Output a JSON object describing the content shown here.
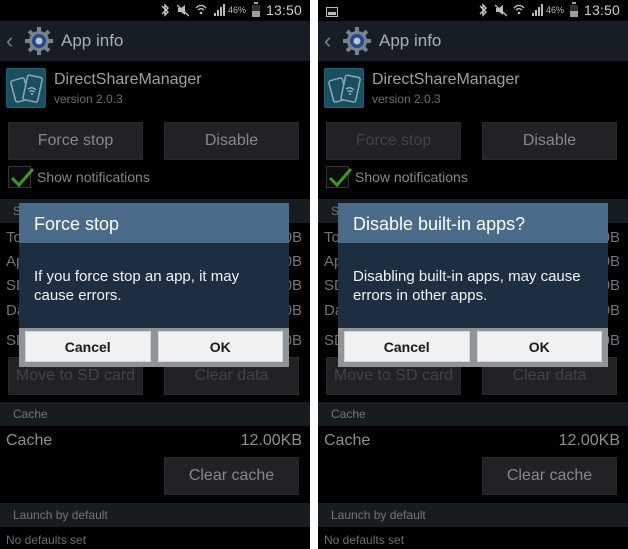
{
  "screens": [
    {
      "id": "left",
      "status_bar": {
        "icons": [
          "bluetooth-icon",
          "mute-icon",
          "wifi-icon",
          "signal-icon"
        ],
        "battery_percent": "46%",
        "time": "13:50",
        "notification_icons": []
      },
      "action_bar": {
        "back_icon": "chevron-left-icon",
        "app_icon": "settings-gear-icon",
        "title": "App info"
      },
      "app": {
        "icon": "direct-share-icon",
        "name": "DirectShareManager",
        "version": "version 2.0.3"
      },
      "buttons": {
        "force_stop": "Force stop",
        "disable": "Disable",
        "move_to_sd": "Move to SD card",
        "clear_data": "Clear data",
        "clear_cache": "Clear cache"
      },
      "force_stop_enabled": true,
      "show_notifications": {
        "label": "Show notifications",
        "checked": true
      },
      "storage": {
        "header": "S",
        "rows": [
          {
            "label": "To",
            "value": "0B"
          },
          {
            "label": "Ap",
            "value": "0B"
          },
          {
            "label": "SD",
            "value": "0B"
          },
          {
            "label": "Da",
            "value": "0B"
          },
          {
            "label": "SD",
            "value": "0B"
          }
        ]
      },
      "cache": {
        "header": "Cache",
        "label": "Cache",
        "value": "12.00KB"
      },
      "launch": {
        "header": "Launch by default",
        "text": "No defaults set"
      },
      "dialog": {
        "title": "Force stop",
        "message": "If you force stop an app, it may cause errors.",
        "cancel": "Cancel",
        "ok": "OK"
      }
    },
    {
      "id": "right",
      "status_bar": {
        "icons": [
          "bluetooth-icon",
          "mute-icon",
          "wifi-icon",
          "signal-icon"
        ],
        "battery_percent": "46%",
        "time": "13:50",
        "notification_icons": [
          "gallery-icon"
        ]
      },
      "action_bar": {
        "back_icon": "chevron-left-icon",
        "app_icon": "settings-gear-icon",
        "title": "App info"
      },
      "app": {
        "icon": "direct-share-icon",
        "name": "DirectShareManager",
        "version": "version 2.0.3"
      },
      "buttons": {
        "force_stop": "Force stop",
        "disable": "Disable",
        "move_to_sd": "Move to SD card",
        "clear_data": "Clear data",
        "clear_cache": "Clear cache"
      },
      "force_stop_enabled": false,
      "show_notifications": {
        "label": "Show notifications",
        "checked": true
      },
      "storage": {
        "header": "S",
        "rows": [
          {
            "label": "To",
            "value": "0B"
          },
          {
            "label": "Ap",
            "value": "0B"
          },
          {
            "label": "SD",
            "value": "0B"
          },
          {
            "label": "Da",
            "value": "0B"
          },
          {
            "label": "SD",
            "value": "0B"
          }
        ]
      },
      "cache": {
        "header": "Cache",
        "label": "Cache",
        "value": "12.00KB"
      },
      "launch": {
        "header": "Launch by default",
        "text": "No defaults set"
      },
      "dialog": {
        "title": "Disable built-in apps?",
        "message": "Disabling built-in apps, may cause errors in other apps.",
        "cancel": "Cancel",
        "ok": "OK"
      }
    }
  ],
  "colors": {
    "action_bar": "#1a232b",
    "dialog_title": "#4a6b89",
    "dialog_body": "#1c2e3f",
    "checkbox_check": "#4caf2f",
    "app_icon_bg": "#1f5d73"
  }
}
